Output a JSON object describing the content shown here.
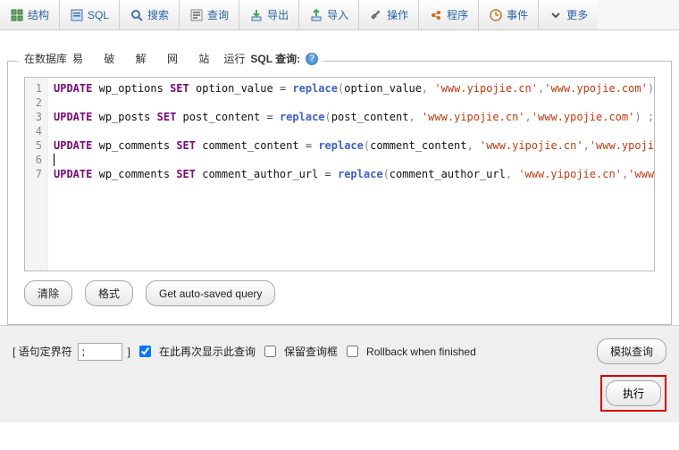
{
  "toolbar": {
    "tabs": [
      {
        "label": "结构",
        "icon": "struct"
      },
      {
        "label": "SQL",
        "icon": "sql"
      },
      {
        "label": "搜索",
        "icon": "search"
      },
      {
        "label": "查询",
        "icon": "query"
      },
      {
        "label": "导出",
        "icon": "export"
      },
      {
        "label": "导入",
        "icon": "import"
      },
      {
        "label": "操作",
        "icon": "wrench"
      },
      {
        "label": "程序",
        "icon": "routines"
      },
      {
        "label": "事件",
        "icon": "events"
      },
      {
        "label": "更多",
        "icon": "more"
      }
    ]
  },
  "panel": {
    "prefix": "在数据库",
    "dbname": "易 破 解 网 站",
    "suffix1": "运行",
    "suffix2": "SQL 查询:"
  },
  "sql": {
    "lines": [
      "1",
      "2",
      "3",
      "4",
      "5",
      "6",
      "7"
    ],
    "stmts": [
      {
        "table": "wp_options",
        "col": "option_value",
        "old": "www.yipojie.cn",
        "new": "www.ypojie.com"
      },
      {
        "table": "wp_posts",
        "col": "post_content",
        "old": "www.yipojie.cn",
        "new": "www.ypojie.com"
      },
      {
        "table": "wp_comments",
        "col": "comment_content",
        "old": "www.yipojie.cn",
        "new": "www.ypojie.com"
      },
      {
        "table": "wp_comments",
        "col": "comment_author_url",
        "old": "www.yipojie.cn",
        "new": "www.ypojie.com"
      }
    ]
  },
  "buttons": {
    "clear": "清除",
    "format": "格式",
    "autosaved": "Get auto-saved query",
    "simulate": "模拟查询",
    "execute": "执行"
  },
  "bottom": {
    "delim_label_open": "[ 语句定界符",
    "delim_value": ";",
    "delim_label_close": "]",
    "retain": "在此再次显示此查询",
    "keepbox": "保留查询框",
    "rollback": "Rollback when finished",
    "retain_checked": true,
    "keepbox_checked": false,
    "rollback_checked": false
  }
}
